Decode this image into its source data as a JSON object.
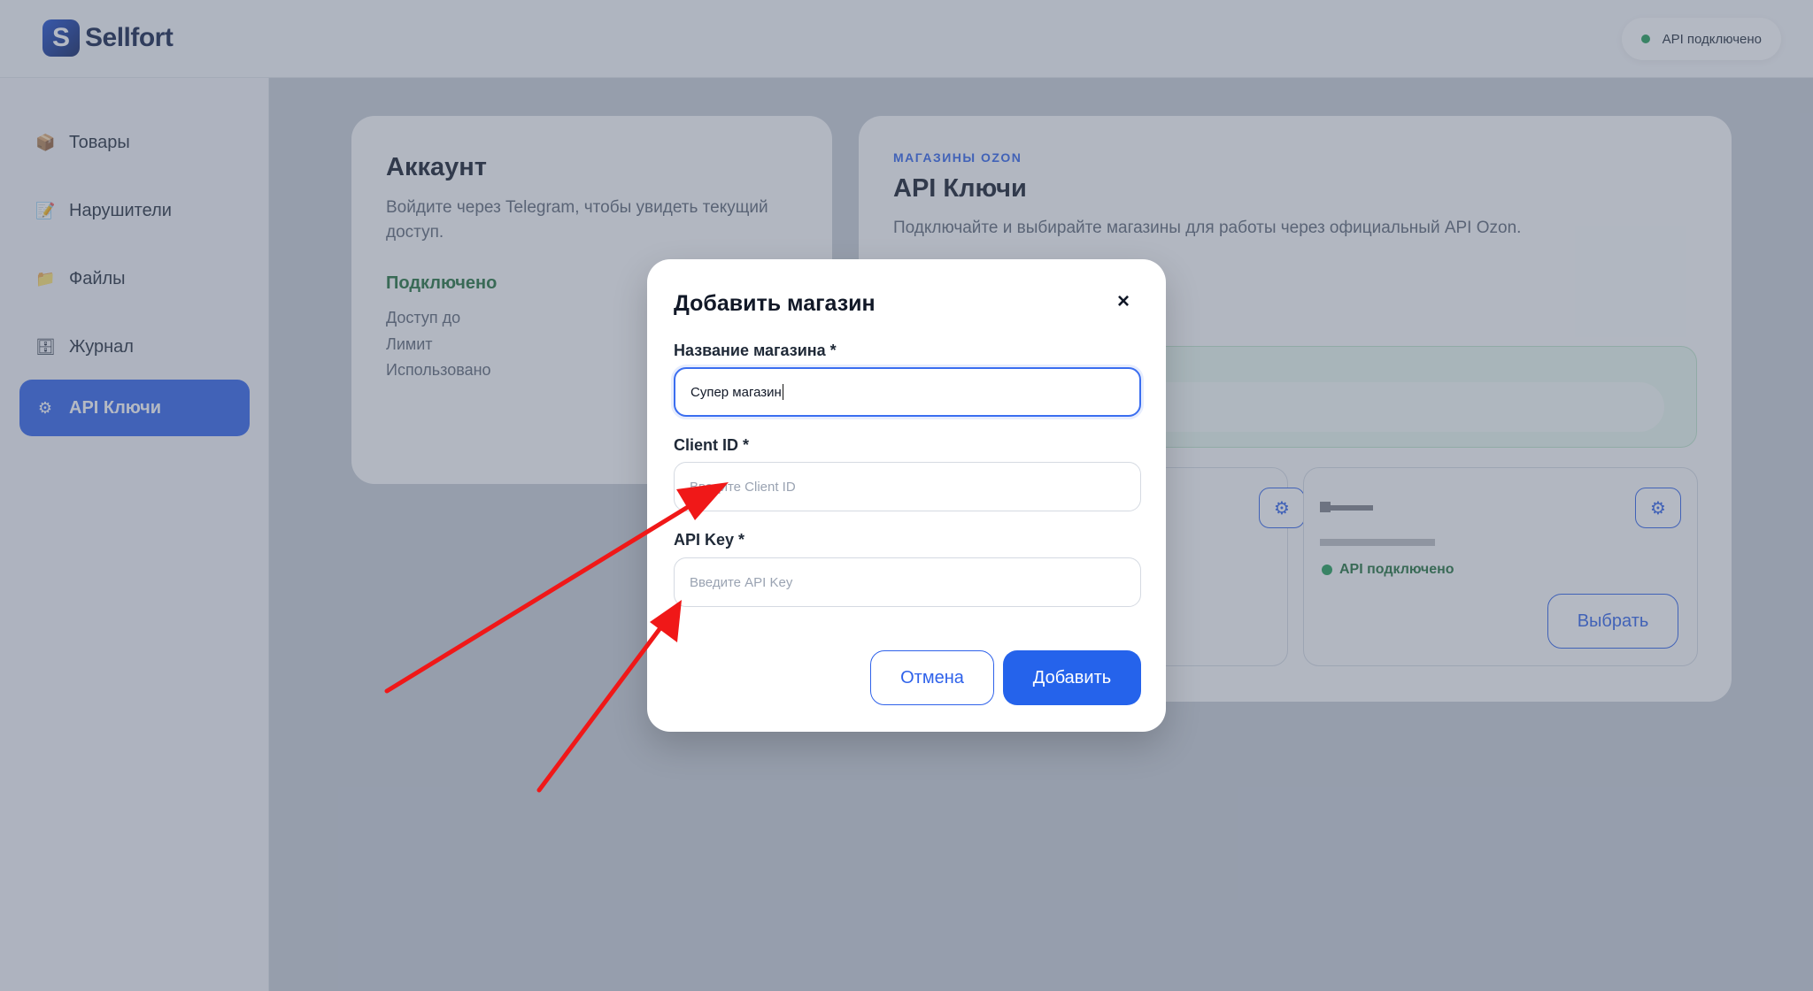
{
  "header": {
    "brand": "Sellfort",
    "brand_mark": "S",
    "api_status": "API подключено"
  },
  "sidebar": {
    "items": [
      {
        "label": "Товары",
        "icon": "📦"
      },
      {
        "label": "Нарушители",
        "icon": "📝"
      },
      {
        "label": "Файлы",
        "icon": "📁"
      },
      {
        "label": "Журнал",
        "icon": "🗄"
      },
      {
        "label": "API Ключи",
        "icon": "⚙",
        "active": true
      }
    ]
  },
  "account": {
    "title": "Аккаунт",
    "description": "Войдите через Telegram, чтобы увидеть текущий доступ.",
    "status": "Подключено",
    "rows": [
      "Доступ до",
      "Лимит",
      "Использовано"
    ]
  },
  "api_keys": {
    "eyebrow": "МАГАЗИНЫ OZON",
    "title": "API Ключи",
    "description": "Подключайте и выбирайте магазины для работы через официальный API Ozon.",
    "store_status": "API подключено",
    "select_label": "Выбрать"
  },
  "modal": {
    "title": "Добавить магазин",
    "store_name_label": "Название магазина *",
    "store_name_value": "Супер магазин",
    "client_id_label": "Client ID *",
    "client_id_placeholder": "Введите Client ID",
    "api_key_label": "API Key *",
    "api_key_placeholder": "Введите API Key",
    "cancel_label": "Отмена",
    "add_label": "Добавить"
  },
  "colors": {
    "accent": "#2563eb",
    "success": "#1f9d55",
    "annotation_arrow": "#f01818"
  },
  "icons": {
    "close": "×",
    "gear": "⚙"
  }
}
